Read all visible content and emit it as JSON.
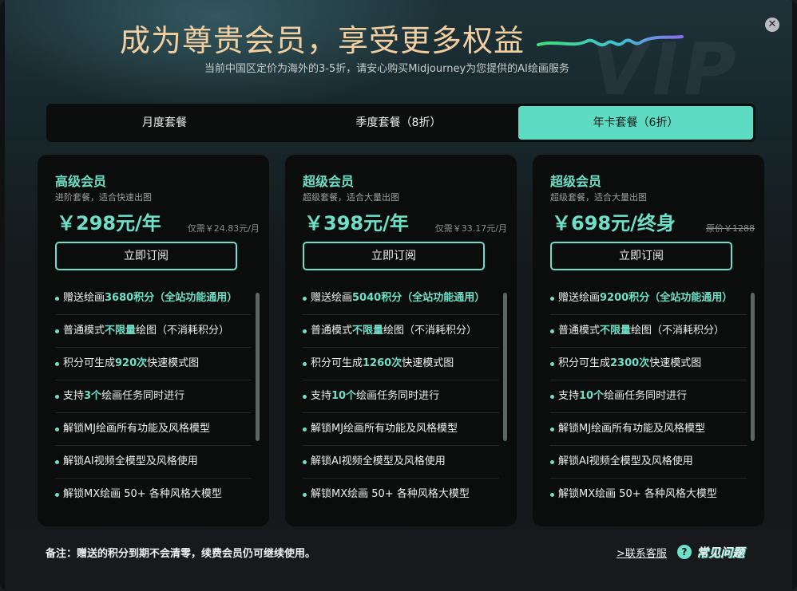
{
  "header": {
    "title": "成为尊贵会员，享受更多权益",
    "subtitle": "当前中国区定价为海外的3-5折，请安心购买Midjourney为您提供的AI绘画服务",
    "watermark": "VIP",
    "close_icon": "close-icon",
    "close_glyph": "✕"
  },
  "tabs": [
    {
      "label": "月度套餐",
      "active": false
    },
    {
      "label": "季度套餐（8折）",
      "active": false
    },
    {
      "label": "年卡套餐（6折）",
      "active": true
    }
  ],
  "colors": {
    "accent": "#6fe0c8",
    "active_tab": "#5edcc3",
    "title": "#f3cfa0",
    "card_bg": "#0b0c0c"
  },
  "plans": [
    {
      "name": "高级会员",
      "desc": "进阶套餐，适合快速出图",
      "price": "￥298元/年",
      "note": "仅需￥24.83元/月",
      "note_strike": false,
      "button": "立即订阅",
      "features": [
        [
          {
            "t": "赠送绘画"
          },
          {
            "t": "3680积分（全站功能通用）",
            "h": true
          }
        ],
        [
          {
            "t": "普通模式"
          },
          {
            "t": "不限量",
            "h": true
          },
          {
            "t": "绘图（不消耗积分）"
          }
        ],
        [
          {
            "t": "积分可生成"
          },
          {
            "t": "920次",
            "h": true
          },
          {
            "t": "快速模式图"
          }
        ],
        [
          {
            "t": "支持"
          },
          {
            "t": "3个",
            "h": true
          },
          {
            "t": "绘画任务同时进行"
          }
        ],
        [
          {
            "t": "解锁MJ绘画所有功能及风格模型"
          }
        ],
        [
          {
            "t": "解锁AI视频全模型及风格使用"
          }
        ],
        [
          {
            "t": "解锁MX绘画 50+ 各种风格大模型"
          }
        ]
      ]
    },
    {
      "name": "超级会员",
      "desc": "超级套餐，适合大量出图",
      "price": "￥398元/年",
      "note": "仅需￥33.17元/月",
      "note_strike": false,
      "button": "立即订阅",
      "features": [
        [
          {
            "t": "赠送绘画"
          },
          {
            "t": "5040积分（全站功能通用）",
            "h": true
          }
        ],
        [
          {
            "t": "普通模式"
          },
          {
            "t": "不限量",
            "h": true
          },
          {
            "t": "绘图（不消耗积分）"
          }
        ],
        [
          {
            "t": "积分可生成"
          },
          {
            "t": "1260次",
            "h": true
          },
          {
            "t": "快速模式图"
          }
        ],
        [
          {
            "t": "支持"
          },
          {
            "t": "10个",
            "h": true
          },
          {
            "t": "绘画任务同时进行"
          }
        ],
        [
          {
            "t": "解锁MJ绘画所有功能及风格模型"
          }
        ],
        [
          {
            "t": "解锁AI视频全模型及风格使用"
          }
        ],
        [
          {
            "t": "解锁MX绘画 50+ 各种风格大模型"
          }
        ]
      ]
    },
    {
      "name": "超级会员",
      "desc": "超级套餐，适合大量出图",
      "price": "￥698元/终身",
      "note": "原价￥1288",
      "note_strike": true,
      "button": "立即订阅",
      "features": [
        [
          {
            "t": "赠送绘画"
          },
          {
            "t": "9200积分（全站功能通用）",
            "h": true
          }
        ],
        [
          {
            "t": "普通模式"
          },
          {
            "t": "不限量",
            "h": true
          },
          {
            "t": "绘图（不消耗积分）"
          }
        ],
        [
          {
            "t": "积分可生成"
          },
          {
            "t": "2300次",
            "h": true
          },
          {
            "t": "快速模式图"
          }
        ],
        [
          {
            "t": "支持"
          },
          {
            "t": "10个",
            "h": true
          },
          {
            "t": "绘画任务同时进行"
          }
        ],
        [
          {
            "t": "解锁MJ绘画所有功能及风格模型"
          }
        ],
        [
          {
            "t": "解锁AI视频全模型及风格使用"
          }
        ],
        [
          {
            "t": "解锁MX绘画 50+ 各种风格大模型"
          }
        ]
      ]
    }
  ],
  "footer": {
    "note": "备注：赠送的积分到期不会清零，续费会员仍可继续使用。",
    "contact": ">联系客服",
    "faq_icon": "question-icon",
    "faq_glyph": "?",
    "faq": "常见问题"
  }
}
